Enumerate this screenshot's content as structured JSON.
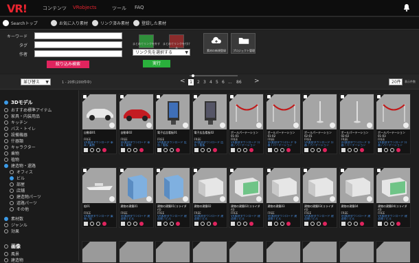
{
  "topnav": {
    "logo": "VR",
    "logo_mark": "!",
    "items": [
      "コンテンツ",
      "VRobjects",
      "ツール",
      "FAQ"
    ]
  },
  "subnav": {
    "tabs": [
      "Searchトップ",
      "お気に入り素材",
      "リンク済み素材",
      "登録した素材"
    ]
  },
  "search": {
    "keyword_label": "キーワード",
    "tag_label": "タグ",
    "author_label": "作者",
    "filter_button": "絞り込み検索",
    "link_select": "リンク先を選択する",
    "run_button": "実行",
    "square_labels": [
      "まとめてリンクを外す",
      "まとめてリンクを付ける"
    ],
    "right_buttons": [
      "素材の新規登録",
      "プロジェクト管理"
    ]
  },
  "pager": {
    "sort": "並び替え",
    "count": "1 - 20件(200件中)",
    "pages": [
      "1",
      "2",
      "3",
      "4",
      "5",
      "6",
      "...",
      "86"
    ],
    "prev": "<",
    "next": ">",
    "per_page": "20件",
    "per_page_label": "表示件数"
  },
  "sidebar": {
    "section1": "3Dモデル",
    "categories": [
      "おすすめ標準アイテム",
      "家具・内装用品",
      "キッチン",
      "バス・トイレ",
      "設備機器",
      "什器類",
      "キャラクター",
      "乗物",
      "植物",
      "建造物・還路"
    ],
    "subcategories": [
      "オフィス",
      "ビル",
      "部屋",
      "店舗",
      "建造物パーツ",
      "道路パーツ",
      "その他"
    ],
    "extras": [
      "素材数",
      "ジャンル",
      "効果"
    ],
    "section2": "画像",
    "section2_items": [
      "風景",
      "建造物"
    ]
  },
  "cards": [
    {
      "title": "自動車01",
      "price": "FREE",
      "meta": "VR素材ダウンロード 車両 / 乗物",
      "thumb": "car-white"
    },
    {
      "title": "自動車02",
      "price": "FREE",
      "meta": "VR素材ダウンロード 車両 / 乗物",
      "thumb": "car-red"
    },
    {
      "title": "電子広告看板01",
      "price": "FREE",
      "meta": "VR素材ダウンロード 広告 / 看板",
      "thumb": "sign-blue"
    },
    {
      "title": "電子広告看板02",
      "price": "FREE",
      "meta": "VR素材ダウンロード 広告 / 看板",
      "thumb": "sign-dark"
    },
    {
      "title": "ポールパーテーション01-01",
      "price": "FREE",
      "meta": "VR素材ダウンロード 什器 / パーテーション",
      "thumb": "rope"
    },
    {
      "title": "ポールパーテーション01-02",
      "price": "FREE",
      "meta": "VR素材ダウンロード 什器 / パーテーション",
      "thumb": "rope"
    },
    {
      "title": "ポールパーテーション02-01",
      "price": "FREE",
      "meta": "VR素材ダウンロード 什器 / パーテーション",
      "thumb": "pole"
    },
    {
      "title": "ポールパーテーション02-02",
      "price": "FREE",
      "meta": "VR素材ダウンロード 什器 / パーテーション",
      "thumb": "pole"
    },
    {
      "title": "ポールパーテーション01-03",
      "price": "FREE",
      "meta": "VR素材ダウンロード 什器 / パーテーション",
      "thumb": "rope"
    },
    {
      "title": "船01",
      "price": "FREE",
      "meta": "VR素材ダウンロード 乗物 / 船",
      "thumb": "boat"
    },
    {
      "title": "建物の建築01",
      "price": "FREE",
      "meta": "VR素材ダウンロード 建造物 / ビル",
      "thumb": "bldg-blue"
    },
    {
      "title": "建物の建築01(コライダ付)",
      "price": "FREE",
      "meta": "VR素材ダウンロード 建造物 / ビル",
      "thumb": "bldg-blue"
    },
    {
      "title": "建物の建築02",
      "price": "FREE",
      "meta": "VR素材ダウンロード 建造物 / ビル",
      "thumb": "bldg-white"
    },
    {
      "title": "建物の建築02(コライダ付)",
      "price": "FREE",
      "meta": "VR素材ダウンロード 建造物 / ビル",
      "thumb": "bldg-green"
    },
    {
      "title": "建物の建築03",
      "price": "FREE",
      "meta": "VR素材ダウンロード 建造物 / ビル",
      "thumb": "bldg-white"
    },
    {
      "title": "建物の建築03(コライダ付)",
      "price": "FREE",
      "meta": "VR素材ダウンロード 建造物 / ビル",
      "thumb": "bldg-white"
    },
    {
      "title": "建物の建築04",
      "price": "FREE",
      "meta": "VR素材ダウンロード 建造物 / ビル",
      "thumb": "bldg-white"
    },
    {
      "title": "建物の建築04(コライダ付)",
      "price": "FREE",
      "meta": "VR素材ダウンロード 建造物 / ビル",
      "thumb": "bldg-green"
    }
  ],
  "colors": {
    "accent": "#e8242f",
    "green": "#2ab03c",
    "pink": "#e0245e",
    "blue": "#3c9be8"
  }
}
